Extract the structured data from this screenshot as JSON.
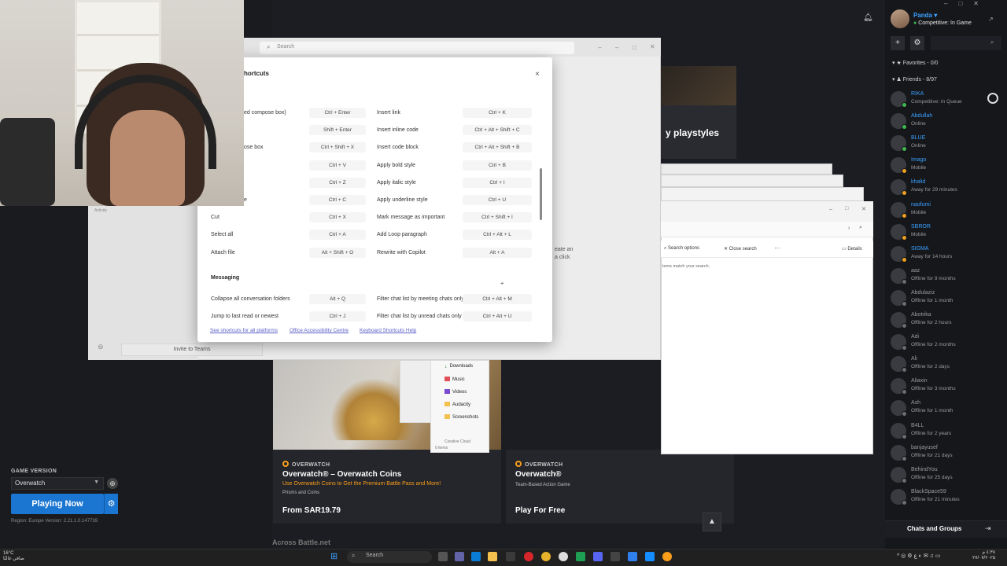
{
  "store": {
    "promo_title": "y playstyles",
    "cards": [
      {
        "brand": "OVERWATCH",
        "title": "Overwatch® – Overwatch Coins",
        "subtitle": "Use Overwatch Coins to Get the Premium Battle Pass and More!",
        "category": "Prisms and Coins",
        "price": "From SAR19.79"
      },
      {
        "brand": "OVERWATCH",
        "title": "Overwatch®",
        "subtitle": "Team-Based Action Game",
        "category": "",
        "price": "Play For Free"
      }
    ],
    "section_next": "Across Battle.net",
    "up_icon": "chevron-up-icon"
  },
  "game_panel": {
    "version_label": "GAME VERSION",
    "version_value": "Overwatch",
    "play_label": "Playing Now",
    "region_info": "Region: Europe   Version: 2.21.1.0.147739"
  },
  "teams": {
    "search_placeholder": "Search",
    "activity_label": "Activity",
    "invite_label": "Invite to Teams",
    "create_text_1": "eate an",
    "create_text_2": "a click"
  },
  "shortcuts_dialog": {
    "title": "hortcuts",
    "close": "×",
    "rows": [
      {
        "l1": "ed compose box)",
        "k1": "Ctrl + Enter",
        "l2": "Insert link",
        "k2": "Ctrl + K"
      },
      {
        "l1": "",
        "k1": "Shift + Enter",
        "l2": "Insert inline code",
        "k2": "Ctrl + Alt + Shift + C"
      },
      {
        "l1": "ose box",
        "k1": "Ctrl + Shift + X",
        "l2": "Insert code block",
        "k2": "Ctrl + Alt + Shift + B"
      },
      {
        "l1": "",
        "k1": "Ctrl + V",
        "l2": "Apply bold style",
        "k2": "Ctrl + B"
      },
      {
        "l1": "",
        "k1": "Ctrl + Z",
        "l2": "Apply italic style",
        "k2": "Ctrl + I"
      },
      {
        "l1": "e",
        "k1": "Ctrl + C",
        "l2": "Apply underline style",
        "k2": "Ctrl + U"
      },
      {
        "l1": "Cut",
        "k1": "Ctrl + X",
        "l2": "Mark message as important",
        "k2": "Ctrl + Shift + I"
      },
      {
        "l1": "Select all",
        "k1": "Ctrl + A",
        "l2": "Add Loop paragraph",
        "k2": "Ctrl + Alt + L"
      },
      {
        "l1": "Attach file",
        "k1": "Alt + Shift + O",
        "l2": "Rewrite with Copilot",
        "k2": "Alt + A"
      }
    ],
    "messaging_heading": "Messaging",
    "messaging_rows": [
      {
        "l1": "Collapse all conversation folders",
        "k1": "Alt + Q",
        "l2": "Filter chat list by meeting chats only",
        "k2": "Ctrl + Alt + M"
      },
      {
        "l1": "Jump to last read or newest",
        "k1": "Ctrl + J",
        "l2": "Filter chat list by unread chats only",
        "k2": "Ctrl + Alt + U"
      }
    ],
    "links": [
      "See shortcuts for all platforms",
      "Office Accessibility Centre",
      "Keyboard Shortcuts Help"
    ]
  },
  "explorer": {
    "search_options": "Search options",
    "close_search": "Close search",
    "more": "···",
    "details": "Details",
    "empty_text": "tems match your search.",
    "nav_items": [
      "Downloads",
      "Music",
      "Videos",
      "Audacity",
      "Screenshots",
      "Creative Cloud"
    ],
    "status": "0 items"
  },
  "sidebar": {
    "profile_name": "Panda",
    "profile_status": "Competitive: In Game",
    "favorites_label": "Favorites - 0/0",
    "friends_label": "Friends - 8/97",
    "friends": [
      {
        "name": "RIKA",
        "status": "Competitive: In Queue",
        "online": true,
        "color": "#3aa0ff"
      },
      {
        "name": "Abdullah",
        "status": "Online",
        "online": true,
        "color": "#3aa0ff"
      },
      {
        "name": "BLUE",
        "status": "Online",
        "online": true,
        "color": "#3aa0ff"
      },
      {
        "name": "Imago",
        "status": "Mobile",
        "online": true,
        "color": "#3aa0ff"
      },
      {
        "name": "khalid",
        "status": "Away for 29 minutes",
        "online": true,
        "color": "#3aa0ff"
      },
      {
        "name": "naofumi",
        "status": "Mobile",
        "online": true,
        "color": "#3aa0ff"
      },
      {
        "name": "SBROR",
        "status": "Mobile",
        "online": true,
        "color": "#3aa0ff"
      },
      {
        "name": "SIGMA",
        "status": "Away for 14 hours",
        "online": true,
        "color": "#3aa0ff"
      },
      {
        "name": "aaz",
        "status": "Offline for 9 months",
        "online": false,
        "color": "#9a9a9a"
      },
      {
        "name": "Abdulaziz",
        "status": "Offline for 1 month",
        "online": false,
        "color": "#9a9a9a"
      },
      {
        "name": "Abotrika",
        "status": "Offline for 2 hours",
        "online": false,
        "color": "#9a9a9a"
      },
      {
        "name": "Adi",
        "status": "Offline for 2 months",
        "online": false,
        "color": "#9a9a9a"
      },
      {
        "name": "Ali",
        "status": "Offline for 2 days",
        "online": false,
        "color": "#9a9a9a"
      },
      {
        "name": "Aliaxin",
        "status": "Offline for 3 months",
        "online": false,
        "color": "#9a9a9a"
      },
      {
        "name": "Ash",
        "status": "Offline for 1 month",
        "online": false,
        "color": "#9a9a9a"
      },
      {
        "name": "B4LL",
        "status": "Offline for 2 years",
        "online": false,
        "color": "#9a9a9a"
      },
      {
        "name": "banjayusef",
        "status": "Offline for 21 days",
        "online": false,
        "color": "#9a9a9a"
      },
      {
        "name": "BehindYou",
        "status": "Offline for 25 days",
        "online": false,
        "color": "#9a9a9a"
      },
      {
        "name": "BlackSpace59",
        "status": "Offline for 21 minutes",
        "online": false,
        "color": "#9a9a9a"
      }
    ],
    "chats_label": "Chats and Groups"
  },
  "taskbar": {
    "weather_temp": "16°C",
    "weather_desc": "صافي غالبًا",
    "search_label": "Search",
    "time": "٤:٣٨ م",
    "date": "٢٧/٠٧/٢٠٢٥"
  },
  "colors": {
    "accent": "#1b76d2",
    "online": "#3fb950",
    "away": "#f0a020",
    "offline": "#6d6d6d",
    "overwatch": "#f99e1a"
  }
}
